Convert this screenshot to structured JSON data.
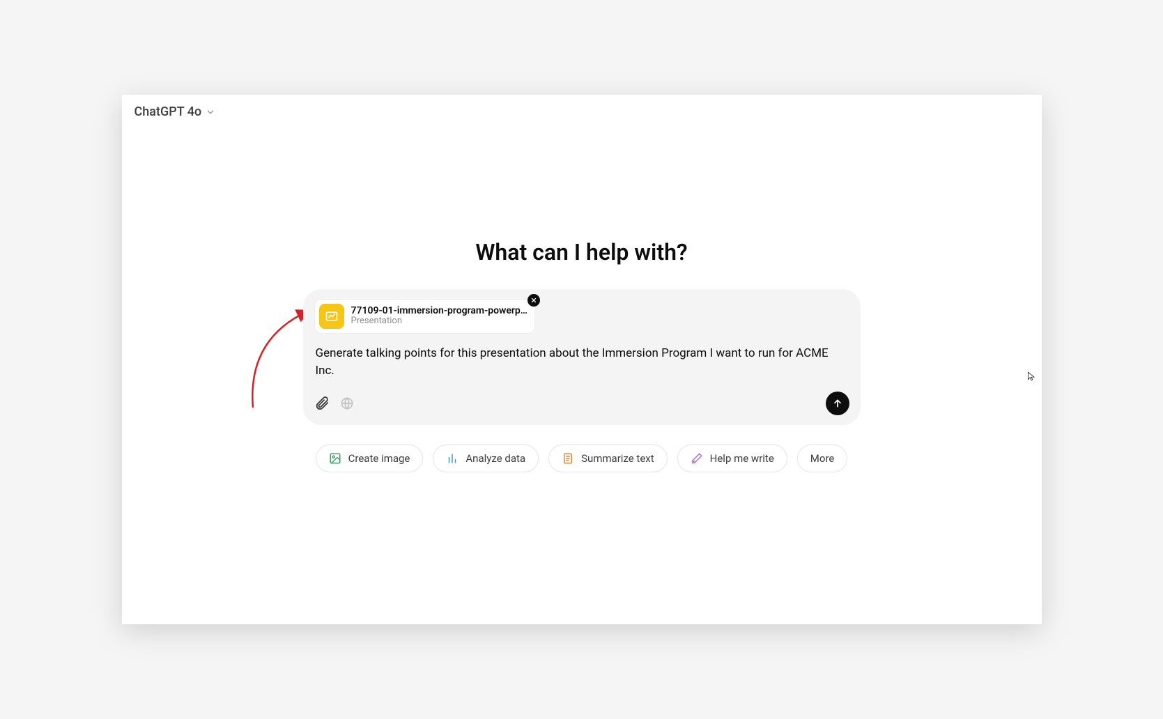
{
  "header": {
    "model_label": "ChatGPT 4o"
  },
  "heading": "What can I help with?",
  "composer": {
    "attachment": {
      "name": "77109-01-immersion-program-powerp…",
      "type": "Presentation"
    },
    "prompt_text": "Generate talking points for this presentation about the Immersion Program I want to run for ACME Inc."
  },
  "suggestions": {
    "create_image": "Create image",
    "analyze_data": "Analyze data",
    "summarize_text": "Summarize text",
    "help_me_write": "Help me write",
    "more": "More"
  }
}
